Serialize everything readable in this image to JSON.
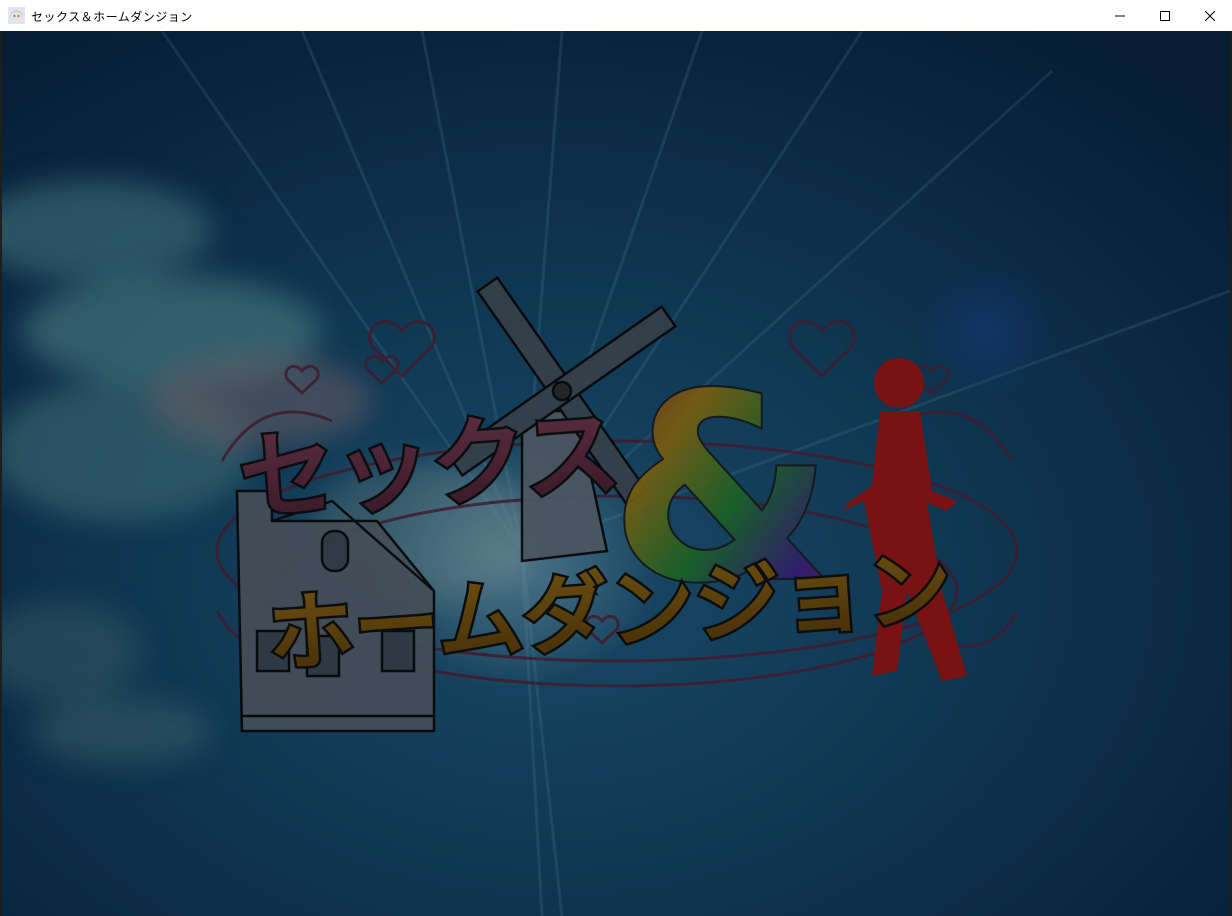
{
  "window": {
    "title": "セックス＆ホームダンジョン",
    "icon": "anime-character-app-icon",
    "controls": {
      "minimize_icon": "minimize-icon",
      "maximize_icon": "maximize-icon",
      "close_icon": "close-icon"
    }
  },
  "title_screen": {
    "logo_line1": "セックス",
    "logo_ampersand": "&",
    "logo_line2": "ホームダンジョン",
    "colors": {
      "sky_dark": "#0a2238",
      "sky_mid": "#12415e",
      "line1_fill": "#5a2a3e",
      "line2_fill": "#6e4a0e",
      "silhouette": "#8a1414",
      "ornament": "#4a1f33"
    }
  }
}
